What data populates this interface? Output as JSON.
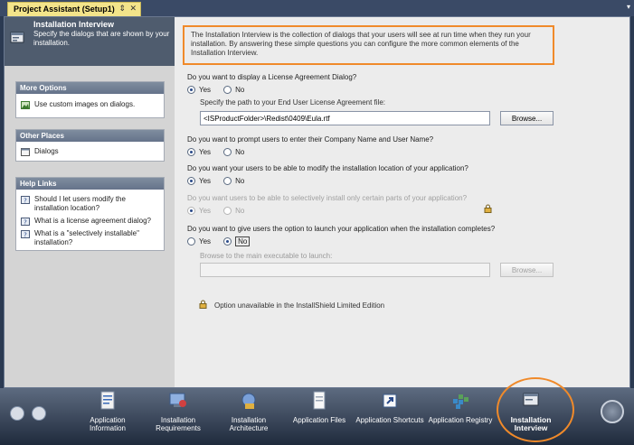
{
  "doc_tab": {
    "title": "Project Assistant (Setup1)",
    "pin": "⇕",
    "close": "✕"
  },
  "tab_dropdown": "▾",
  "left": {
    "header_title": "Installation Interview",
    "header_subtitle": "Specify the dialogs that are shown by your installation.",
    "more_options": {
      "title": "More Options",
      "items": [
        "Use custom images on dialogs."
      ]
    },
    "other_places": {
      "title": "Other Places",
      "items": [
        "Dialogs"
      ]
    },
    "help_links": {
      "title": "Help Links",
      "items": [
        "Should I let users modify the installation location?",
        "What is a license agreement dialog?",
        "What is a \"selectively installable\" installation?"
      ]
    }
  },
  "main": {
    "intro": "The Installation Interview is the collection of dialogs that your users will see at run time when they run your installation. By answering these simple questions you can configure the more common elements of the Installation Interview.",
    "q1": "Do you want to display a License Agreement Dialog?",
    "q1_yes": "Yes",
    "q1_no": "No",
    "eula_label": "Specify the path to your End User License Agreement file:",
    "eula_path": "<ISProductFolder>\\Redist\\0409\\Eula.rtf",
    "browse1": "Browse...",
    "q2": "Do you want to prompt users to enter their Company Name and User Name?",
    "q2_yes": "Yes",
    "q2_no": "No",
    "q3": "Do you want your users to be able to modify the installation location of your application?",
    "q3_yes": "Yes",
    "q3_no": "No",
    "q4": "Do you want users to be able to selectively install only certain parts of your application?",
    "q4_yes": "Yes",
    "q4_no": "No",
    "q5": "Do you want to give users the option to launch your application when the installation completes?",
    "q5_yes": "Yes",
    "q5_no": "No",
    "launch_label": "Browse to the main executable to launch:",
    "launch_path": "",
    "browse2": "Browse...",
    "unavailable": "Option unavailable in the InstallShield Limited Edition",
    "selected": {
      "q1": "Yes",
      "q2": "Yes",
      "q3": "Yes",
      "q4": "Yes",
      "q5": "No"
    }
  },
  "bottom_nav": {
    "items": [
      {
        "label": "Application Information",
        "icon": "app-info-icon",
        "active": false
      },
      {
        "label": "Installation Requirements",
        "icon": "requirements-icon",
        "active": false
      },
      {
        "label": "Installation Architecture",
        "icon": "architecture-icon",
        "active": false
      },
      {
        "label": "Application Files",
        "icon": "files-icon",
        "active": false
      },
      {
        "label": "Application Shortcuts",
        "icon": "shortcut-icon",
        "active": false
      },
      {
        "label": "Application Registry",
        "icon": "registry-icon",
        "active": false
      },
      {
        "label": "Installation Interview",
        "icon": "interview-icon",
        "active": true
      }
    ]
  },
  "colors": {
    "accent_orange": "#f08a2a",
    "header_bg": "#4f5c6e",
    "bar_bg": "#2b3a52"
  }
}
